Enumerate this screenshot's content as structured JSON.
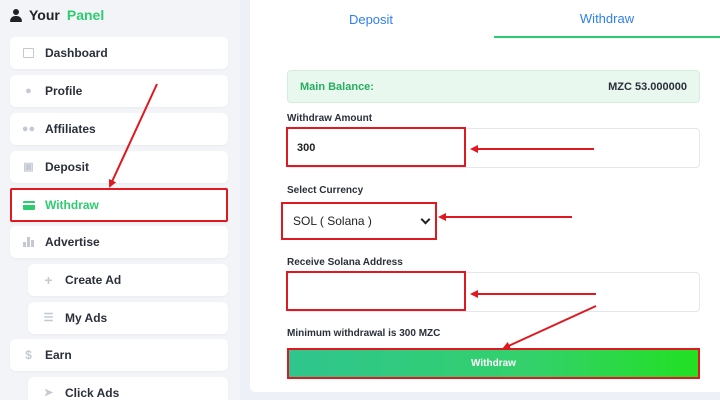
{
  "sidebar": {
    "brand_prefix": "Your",
    "brand_accent": "Panel",
    "items": [
      {
        "label": "Dashboard"
      },
      {
        "label": "Profile"
      },
      {
        "label": "Affiliates"
      },
      {
        "label": "Deposit"
      },
      {
        "label": "Withdraw"
      },
      {
        "label": "Advertise"
      },
      {
        "label": "Create Ad"
      },
      {
        "label": "My Ads"
      },
      {
        "label": "Earn"
      },
      {
        "label": "Click Ads"
      }
    ]
  },
  "tabs": [
    {
      "label": "Deposit"
    },
    {
      "label": "Withdraw"
    }
  ],
  "balance": {
    "label": "Main Balance:",
    "value": "MZC 53.000000"
  },
  "form": {
    "amount_label": "Withdraw Amount",
    "amount_value": "300",
    "currency_label": "Select Currency",
    "currency_value": "SOL ( Solana )",
    "address_label": "Receive Solana Address",
    "address_value": "",
    "min_prefix": "Minimum withdrawal is",
    "min_amount": "300 MZC",
    "submit_label": "Withdraw"
  },
  "colors": {
    "accent_green": "#2ecc71",
    "link_blue": "#2f80ed",
    "annotation_red": "#e0181f"
  }
}
